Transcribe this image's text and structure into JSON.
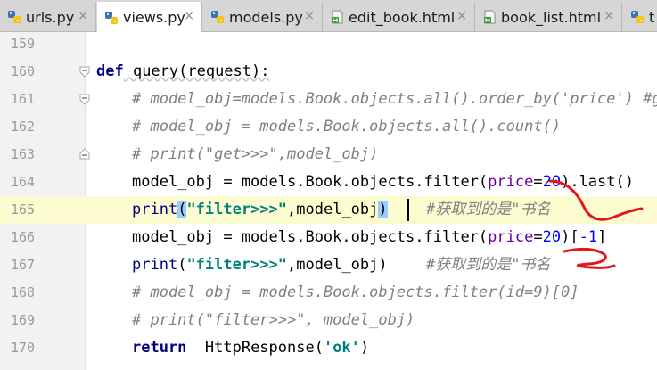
{
  "tabs": [
    {
      "label": "urls.py",
      "icon": "python-file-icon",
      "active": false
    },
    {
      "label": "views.py",
      "icon": "python-file-icon",
      "active": true
    },
    {
      "label": "models.py",
      "icon": "python-file-icon",
      "active": false
    },
    {
      "label": "edit_book.html",
      "icon": "html-file-icon",
      "active": false
    },
    {
      "label": "book_list.html",
      "icon": "html-file-icon",
      "active": false
    },
    {
      "label": "t",
      "icon": "python-file-icon",
      "active": false
    }
  ],
  "close_glyph": "×",
  "lines": [
    {
      "num": "159"
    },
    {
      "num": "160",
      "parts": {
        "def": "def",
        "name": " query(request):"
      }
    },
    {
      "num": "161",
      "parts": {
        "text": "# model_obj=models.Book.objects.all().order_by('price') #ge"
      }
    },
    {
      "num": "162",
      "parts": {
        "text": "# model_obj = models.Book.objects.all().count()"
      }
    },
    {
      "num": "163",
      "parts": {
        "text": "# print(\"get>>>\",model_obj)"
      }
    },
    {
      "num": "164",
      "parts": {
        "a": "model_obj = models.Book.objects.filter(",
        "kwarg": "price",
        "eq": "=",
        "num": "20",
        "b": ").last()"
      }
    },
    {
      "num": "165",
      "parts": {
        "print": "print",
        "po": "(",
        "str": "\"filter>>>\"",
        "rest": ",model_obj",
        "pc": ")",
        "cmt": "#获取到的是\"书名"
      }
    },
    {
      "num": "166",
      "parts": {
        "a": "model_obj = models.Book.objects.filter(",
        "kwarg": "price",
        "eq": "=",
        "num": "20",
        "b": ")[",
        "num2": "-1",
        "c": "]"
      }
    },
    {
      "num": "167",
      "parts": {
        "print": "print",
        "po": "(",
        "str": "\"filter>>>\"",
        "rest": ",model_obj)",
        "cmt": "#获取到的是\"书名"
      }
    },
    {
      "num": "168",
      "parts": {
        "text": "# model_obj = models.Book.objects.filter(id=9)[0]"
      }
    },
    {
      "num": "169",
      "parts": {
        "text": "# print(\"filter>>>\", model_obj)"
      }
    },
    {
      "num": "170",
      "parts": {
        "ret": "return",
        "call": "  HttpResponse(",
        "str": "'ok'",
        "end": ")"
      }
    }
  ],
  "colors": {
    "keyword": "#000080",
    "comment": "#808080",
    "string": "#008080",
    "number": "#0000ff",
    "kwarg": "#660099",
    "current_line": "#fdfbd0",
    "bracket_match": "#99ccff",
    "annotation_ink": "#e8141c"
  }
}
